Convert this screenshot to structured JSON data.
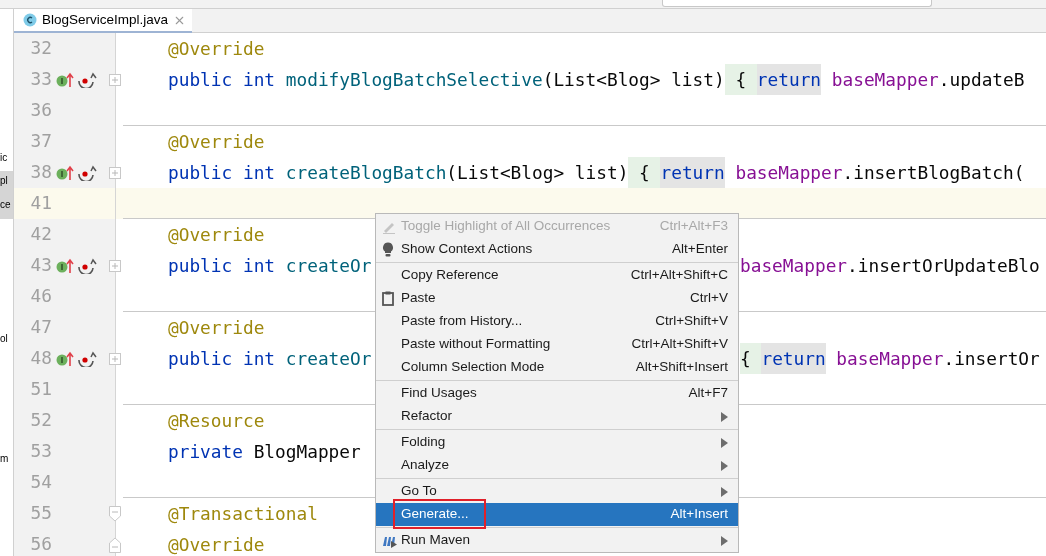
{
  "project_strip": [
    {
      "text": "ic",
      "selected": false
    },
    {
      "text": "pl",
      "selected": true
    },
    {
      "text": "ce",
      "selected": true
    },
    {
      "text": "ol",
      "selected": false
    },
    {
      "text": "m",
      "selected": false
    }
  ],
  "tabs": [
    {
      "label": "BlogServiceImpl.java",
      "selected": true
    }
  ],
  "editor": {
    "blocks": [
      {
        "lines": [
          {
            "number": "32",
            "current": false,
            "kind": "plain",
            "left": [
              {
                "text": "@Override",
                "kind": "annotation"
              }
            ]
          },
          {
            "number": "33",
            "current": false,
            "kind": "collapsed",
            "left": [
              {
                "text": "public int ",
                "kind": "keyword"
              },
              {
                "text": "modifyBlogBatchSelective",
                "kind": "method"
              },
              {
                "text": "(List<Blog> list)",
                "kind": "plain"
              },
              {
                "text": " { ",
                "kind": "brace"
              },
              {
                "text": "return",
                "kind": "return"
              },
              {
                "text": "baseMapper",
                "kind": "field"
              },
              {
                "text": ".updateB",
                "kind": "plain"
              }
            ]
          },
          {
            "number": "36",
            "current": false,
            "kind": "plain"
          }
        ]
      },
      {
        "lines": [
          {
            "number": "37",
            "current": false,
            "kind": "plain",
            "left": [
              {
                "text": "@Override",
                "kind": "annotation"
              }
            ]
          },
          {
            "number": "38",
            "current": false,
            "kind": "collapsed",
            "left": [
              {
                "text": "public int ",
                "kind": "keyword"
              },
              {
                "text": "createBlogBatch",
                "kind": "method"
              },
              {
                "text": "(List<Blog> list)",
                "kind": "plain"
              },
              {
                "text": " { ",
                "kind": "brace"
              },
              {
                "text": "return",
                "kind": "return"
              },
              {
                "text": "baseMapper",
                "kind": "field"
              },
              {
                "text": ".insertBlogBatch(",
                "kind": "plain"
              }
            ]
          },
          {
            "number": "41",
            "current": true,
            "kind": "plain"
          }
        ]
      },
      {
        "lines": [
          {
            "number": "42",
            "current": false,
            "kind": "plain",
            "left": [
              {
                "text": "@Override",
                "kind": "annotation"
              }
            ]
          },
          {
            "number": "43",
            "current": false,
            "kind": "collapsed",
            "left": [
              {
                "text": "public int ",
                "kind": "keyword"
              },
              {
                "text": "createOr",
                "kind": "method"
              }
            ],
            "right": [
              {
                "text": "baseMapper",
                "kind": "field"
              },
              {
                "text": ".insertOrUpdateBlo",
                "kind": "plain"
              }
            ]
          },
          {
            "number": "46",
            "current": false,
            "kind": "plain"
          }
        ]
      },
      {
        "lines": [
          {
            "number": "47",
            "current": false,
            "kind": "plain",
            "left": [
              {
                "text": "@Override",
                "kind": "annotation"
              }
            ]
          },
          {
            "number": "48",
            "current": false,
            "kind": "collapsed",
            "left": [
              {
                "text": "public int ",
                "kind": "keyword"
              },
              {
                "text": "createOr",
                "kind": "method"
              }
            ],
            "right": [
              {
                "text": "{ ",
                "kind": "brace"
              },
              {
                "text": "return",
                "kind": "return"
              },
              {
                "text": "baseMapper",
                "kind": "field"
              },
              {
                "text": ".insertOr",
                "kind": "plain"
              }
            ]
          },
          {
            "number": "51",
            "current": false,
            "kind": "plain"
          }
        ]
      },
      {
        "lines": [
          {
            "number": "52",
            "current": false,
            "kind": "plain",
            "left": [
              {
                "text": "@Resource",
                "kind": "annotation"
              }
            ]
          },
          {
            "number": "53",
            "current": false,
            "kind": "plain",
            "left": [
              {
                "text": "private ",
                "kind": "keyword"
              },
              {
                "text": "BlogMapper",
                "kind": "plain"
              }
            ]
          },
          {
            "number": "54",
            "current": false,
            "kind": "plain"
          }
        ]
      },
      {
        "lines": [
          {
            "number": "55",
            "current": false,
            "kind": "foldstart",
            "left": [
              {
                "text": "@Transactional",
                "kind": "annotation"
              }
            ]
          },
          {
            "number": "56",
            "current": false,
            "kind": "foldend",
            "left": [
              {
                "text": "@Override",
                "kind": "annotation"
              }
            ]
          }
        ]
      }
    ]
  },
  "menu": {
    "groups": [
      {
        "items": [
          {
            "label": "Toggle Highlight of All Occurrences",
            "shortcut": "Ctrl+Alt+F3",
            "kind": "pencil",
            "disabled": true,
            "submenu": false,
            "selected": false,
            "annotated": false
          },
          {
            "label": "Show Context Actions",
            "shortcut": "Alt+Enter",
            "kind": "bulb",
            "disabled": false,
            "submenu": false,
            "selected": false,
            "annotated": false
          }
        ]
      },
      {
        "items": [
          {
            "label": "Copy Reference",
            "shortcut": "Ctrl+Alt+Shift+C",
            "kind": "text",
            "disabled": false,
            "submenu": false,
            "selected": false,
            "annotated": false
          },
          {
            "label": "Paste",
            "shortcut": "Ctrl+V",
            "kind": "clipboard",
            "disabled": false,
            "submenu": false,
            "selected": false,
            "annotated": false
          },
          {
            "label": "Paste from History...",
            "shortcut": "Ctrl+Shift+V",
            "kind": "text",
            "disabled": false,
            "submenu": false,
            "selected": false,
            "annotated": false
          },
          {
            "label": "Paste without Formatting",
            "shortcut": "Ctrl+Alt+Shift+V",
            "kind": "text",
            "disabled": false,
            "submenu": false,
            "selected": false,
            "annotated": false
          },
          {
            "label": "Column Selection Mode",
            "shortcut": "Alt+Shift+Insert",
            "kind": "text",
            "disabled": false,
            "submenu": false,
            "selected": false,
            "annotated": false
          }
        ]
      },
      {
        "items": [
          {
            "label": "Find Usages",
            "shortcut": "Alt+F7",
            "kind": "text",
            "disabled": false,
            "submenu": false,
            "selected": false,
            "annotated": false
          },
          {
            "label": "Refactor",
            "kind": "text",
            "disabled": false,
            "submenu": true,
            "selected": false,
            "annotated": false
          }
        ]
      },
      {
        "items": [
          {
            "label": "Folding",
            "kind": "text",
            "disabled": false,
            "submenu": true,
            "selected": false,
            "annotated": false
          },
          {
            "label": "Analyze",
            "kind": "text",
            "disabled": false,
            "submenu": true,
            "selected": false,
            "annotated": false
          }
        ]
      },
      {
        "items": [
          {
            "label": "Go To",
            "kind": "text",
            "disabled": false,
            "submenu": true,
            "selected": false,
            "annotated": false
          },
          {
            "label": "Generate...",
            "shortcut": "Alt+Insert",
            "kind": "text",
            "disabled": false,
            "submenu": false,
            "selected": true,
            "annotated": true
          }
        ]
      },
      {
        "items": [
          {
            "label": "Run Maven",
            "kind": "maven",
            "disabled": false,
            "submenu": true,
            "selected": false,
            "annotated": false
          }
        ]
      }
    ]
  }
}
